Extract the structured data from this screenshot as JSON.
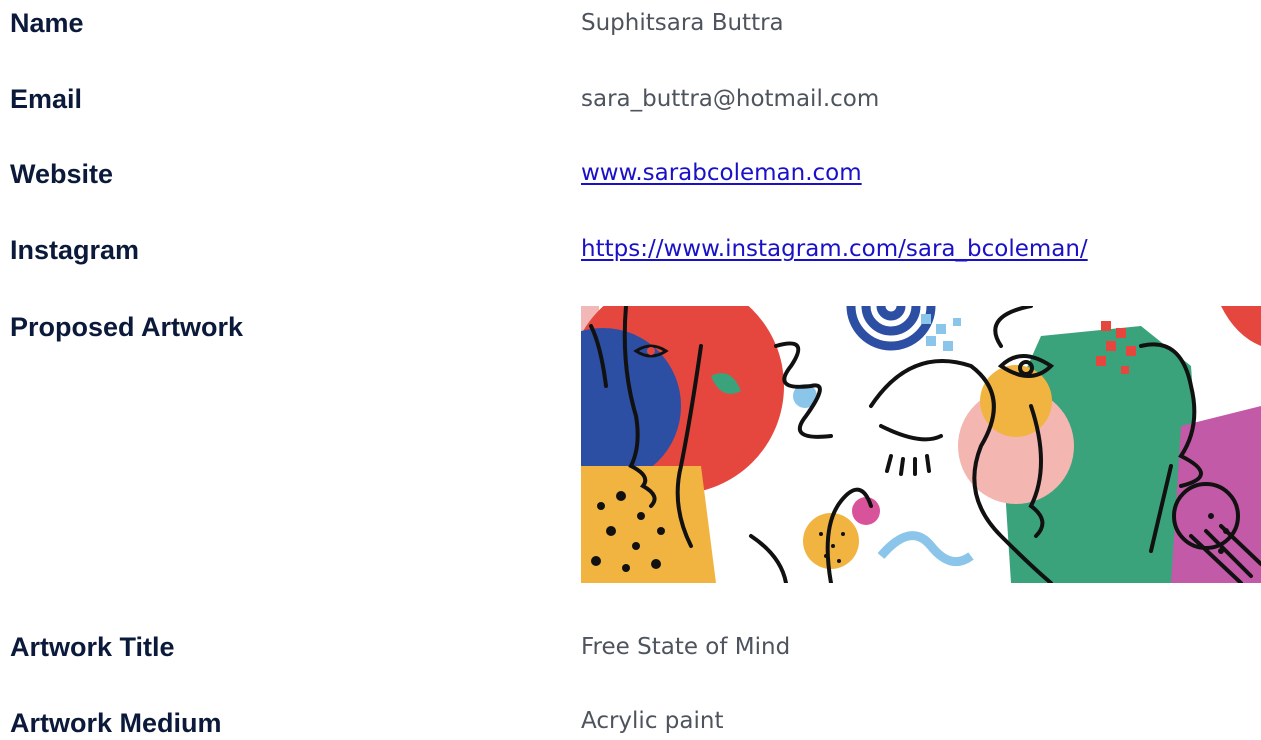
{
  "fields": {
    "name": {
      "label": "Name",
      "value": "Suphitsara Buttra"
    },
    "email": {
      "label": "Email",
      "value": "sara_buttra@hotmail.com"
    },
    "website": {
      "label": "Website",
      "value": "www.sarabcoleman.com"
    },
    "instagram": {
      "label": "Instagram",
      "value": "https://www.instagram.com/sara_bcoleman/"
    },
    "artwork": {
      "label": "Proposed Artwork"
    },
    "title": {
      "label": "Artwork Title",
      "value": "Free State of Mind"
    },
    "medium": {
      "label": "Artwork Medium",
      "value": "Acrylic paint"
    }
  },
  "colors": {
    "label_text": "#0b1a3a",
    "value_text": "#4e545d",
    "link": "#1a10c8"
  }
}
